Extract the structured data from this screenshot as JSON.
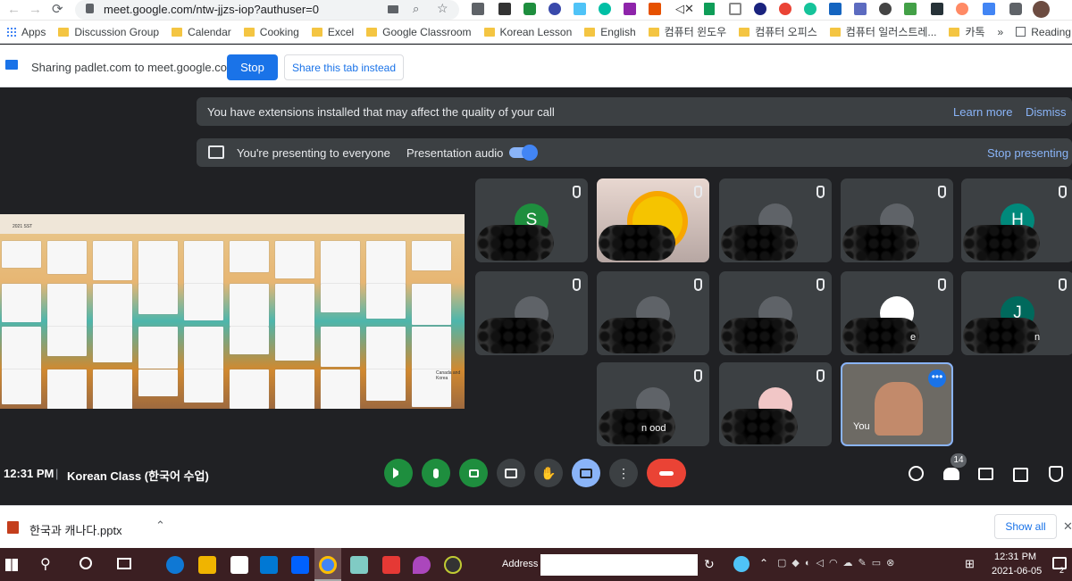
{
  "browser": {
    "url": "meet.google.com/ntw-jjzs-iop?authuser=0"
  },
  "bookmarks": [
    {
      "label": "Apps"
    },
    {
      "label": "Discussion Group"
    },
    {
      "label": "Calendar"
    },
    {
      "label": "Cooking"
    },
    {
      "label": "Excel"
    },
    {
      "label": "Google Classroom"
    },
    {
      "label": "Korean Lesson"
    },
    {
      "label": "English"
    },
    {
      "label": "컴퓨터 윈도우"
    },
    {
      "label": "컴퓨터 오피스"
    },
    {
      "label": "컴퓨터 일러스트레..."
    },
    {
      "label": "카톡"
    }
  ],
  "bookmarks_more": "»",
  "reading_list": "Reading list",
  "share_bar": {
    "text": "Sharing padlet.com to meet.google.com",
    "stop": "Stop",
    "share_this": "Share this tab instead"
  },
  "ext_banner": {
    "text": "You have extensions installed that may affect the quality of your call",
    "learn_more": "Learn more",
    "dismiss": "Dismiss"
  },
  "present_banner": {
    "text": "You're presenting to everyone",
    "audio_label": "Presentation audio",
    "audio_on": true,
    "stop": "Stop presenting"
  },
  "presentation": {
    "title": "2021 SST",
    "card_text": "Canada and Korea"
  },
  "tiles": [
    {
      "initial": "S",
      "color": "#1e8e3e",
      "label": ""
    },
    {
      "initial": "",
      "color": "#f4b400",
      "label": ""
    },
    {
      "initial": "",
      "color": "#5f6368",
      "label": ""
    },
    {
      "initial": "",
      "color": "#5f6368",
      "label": ""
    },
    {
      "initial": "H",
      "color": "#00897b",
      "label": ""
    },
    {
      "initial": "",
      "color": "#5f6368",
      "label": ""
    },
    {
      "initial": "",
      "color": "#5f6368",
      "label": ""
    },
    {
      "initial": "",
      "color": "#5f6368",
      "label": ""
    },
    {
      "initial": "",
      "color": "#ffffff",
      "label": "e"
    },
    {
      "initial": "J",
      "color": "#00695c",
      "label": "n"
    },
    {
      "initial": "",
      "color": "#5f6368",
      "label": "n    ood"
    },
    {
      "initial": "",
      "color": "#f1c6c6",
      "label": ""
    },
    {
      "initial": "",
      "color": "#5f6368",
      "label": "You"
    }
  ],
  "meeting": {
    "time": "12:31 PM",
    "separator": "|",
    "name": "Korean Class (한국어 수업)",
    "participants": "14"
  },
  "download": {
    "filename": "한국과 캐나다.pptx",
    "show_all": "Show all"
  },
  "taskbar": {
    "address_label": "Address",
    "time": "12:31 PM",
    "date": "2021-06-05",
    "notif": "2"
  }
}
